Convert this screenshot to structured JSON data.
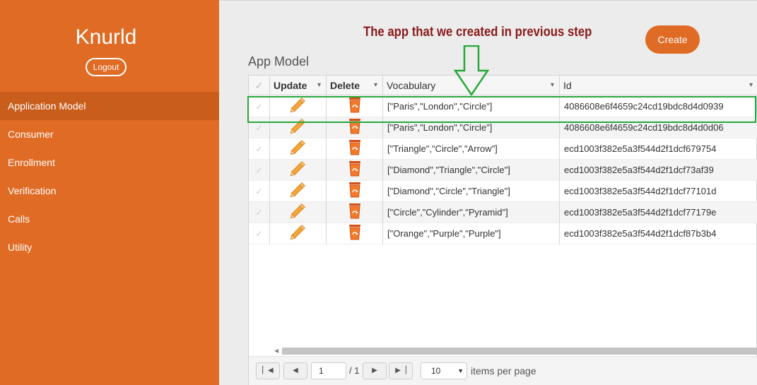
{
  "sidebar": {
    "brand": "Knurld",
    "logout_label": "Logout",
    "items": [
      {
        "label": "Application Model"
      },
      {
        "label": "Consumer"
      },
      {
        "label": "Enrollment"
      },
      {
        "label": "Verification"
      },
      {
        "label": "Calls"
      },
      {
        "label": "Utility"
      }
    ],
    "active_index": 0,
    "color": "#e06b24"
  },
  "annotation": {
    "text": "The app that we created in previous step",
    "color": "#8b1a1a",
    "highlight_color": "#27a83a"
  },
  "header": {
    "create_label": "Create",
    "page_title": "App Model"
  },
  "grid": {
    "columns": {
      "update": "Update",
      "delete": "Delete",
      "vocabulary": "Vocabulary",
      "id": "Id"
    },
    "rows": [
      {
        "vocabulary": "[\"Paris\",\"London\",\"Circle\"]",
        "id": "4086608e6f4659c24cd19bdc8d4d0939"
      },
      {
        "vocabulary": "[\"Paris\",\"London\",\"Circle\"]",
        "id": "4086608e6f4659c24cd19bdc8d4d0d06"
      },
      {
        "vocabulary": "[\"Triangle\",\"Circle\",\"Arrow\"]",
        "id": "ecd1003f382e5a3f544d2f1dcf679754"
      },
      {
        "vocabulary": "[\"Diamond\",\"Triangle\",\"Circle\"]",
        "id": "ecd1003f382e5a3f544d2f1dcf73af39"
      },
      {
        "vocabulary": "[\"Diamond\",\"Circle\",\"Triangle\"]",
        "id": "ecd1003f382e5a3f544d2f1dcf77101d"
      },
      {
        "vocabulary": "[\"Circle\",\"Cylinder\",\"Pyramid\"]",
        "id": "ecd1003f382e5a3f544d2f1dcf77179e"
      },
      {
        "vocabulary": "[\"Orange\",\"Purple\",\"Purple\"]",
        "id": "ecd1003f382e5a3f544d2f1dcf87b3b4"
      }
    ],
    "icons": {
      "update": "pencil-icon",
      "delete": "recycle-bin-icon",
      "check": "check-icon"
    }
  },
  "pager": {
    "page": "1",
    "of_label": "/ 1",
    "page_size": "10",
    "items_per_page_label": "items per page"
  }
}
